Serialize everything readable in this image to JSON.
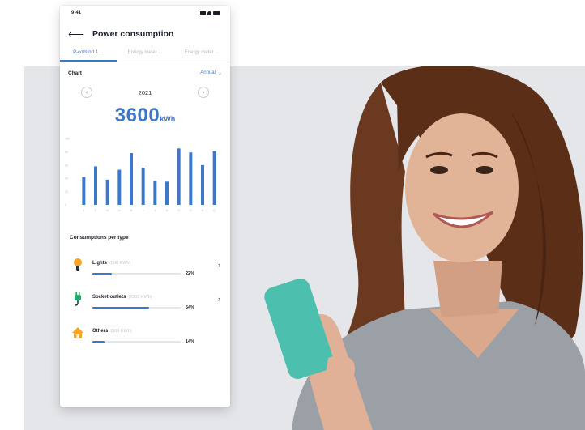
{
  "status": {
    "time": "9:41"
  },
  "nav": {
    "title": "Power consumption"
  },
  "tabs": [
    "P-comfort 1 ...",
    "Energy meter ...",
    "Energy meter ..."
  ],
  "chart_section": {
    "label": "Chart",
    "period": "Annual",
    "year": "2021",
    "total_value": "3600",
    "total_unit": "kWh"
  },
  "chart_data": {
    "type": "bar",
    "categories": [
      "J",
      "F",
      "M",
      "A",
      "M",
      "J",
      "J",
      "A",
      "S",
      "O",
      "N",
      "D"
    ],
    "values": [
      42,
      58,
      38,
      53,
      78,
      56,
      36,
      35,
      85,
      79,
      60,
      81
    ],
    "ylim": [
      0,
      100
    ],
    "yticks": [
      "0",
      "20",
      "40",
      "60",
      "80",
      "100"
    ],
    "grid": false,
    "color": "#3b78c9"
  },
  "consumptions": {
    "label": "Consumptions per type",
    "items": [
      {
        "name": "Lights",
        "kwh": "(500 KWh)",
        "pct_label": "22%",
        "pct": 22,
        "icon": "lightbulb-icon",
        "color": "#f5a623",
        "chevron": true
      },
      {
        "name": "Socket-outlets",
        "kwh": "(2300 KWh)",
        "pct_label": "64%",
        "pct": 64,
        "icon": "plug-icon",
        "color": "#27a86b",
        "chevron": true
      },
      {
        "name": "Others",
        "kwh": "(500 KWh)",
        "pct_label": "14%",
        "pct": 14,
        "icon": "house-icon",
        "color": "#f5a623",
        "chevron": false
      }
    ]
  }
}
